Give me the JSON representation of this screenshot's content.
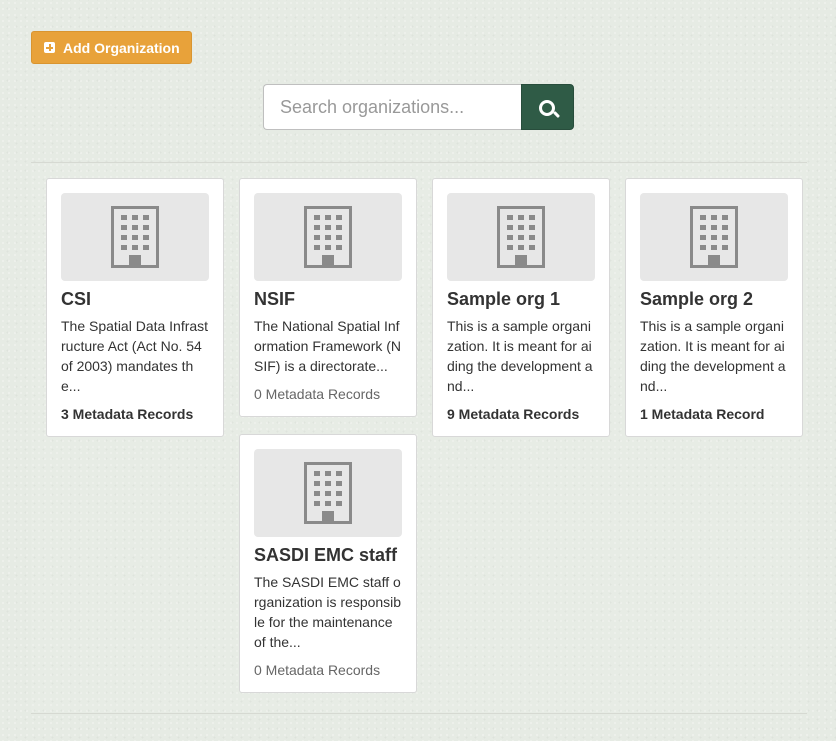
{
  "toolbar": {
    "add_label": "Add Organization"
  },
  "search": {
    "placeholder": "Search organizations..."
  },
  "organizations": [
    {
      "title": "CSI",
      "description": "The Spatial Data Infrastructure Act (Act No. 54 of 2003) mandates the...",
      "records": "3 Metadata Records"
    },
    {
      "title": "NSIF",
      "description": "The National Spatial Information Framework (NSIF) is a directorate...",
      "records": "0 Metadata Records"
    },
    {
      "title": "Sample org 1",
      "description": "This is a sample organization. It is meant for aiding the development and...",
      "records": "9 Metadata Records"
    },
    {
      "title": "Sample org 2",
      "description": "This is a sample organization. It is meant for aiding the development and...",
      "records": "1 Metadata Record"
    },
    {
      "title": "SASDI EMC staff",
      "description": "The SASDI EMC staff organization is responsible for the maintenance of the...",
      "records": "0 Metadata Records"
    }
  ],
  "icons": {
    "add": "plus-square-icon",
    "search": "search-icon",
    "org": "building-icon"
  },
  "colors": {
    "accent": "#e8a23a",
    "primary": "#2f5b46",
    "placeholder_bg": "#e7e7e7",
    "building": "#8a8a8a"
  }
}
